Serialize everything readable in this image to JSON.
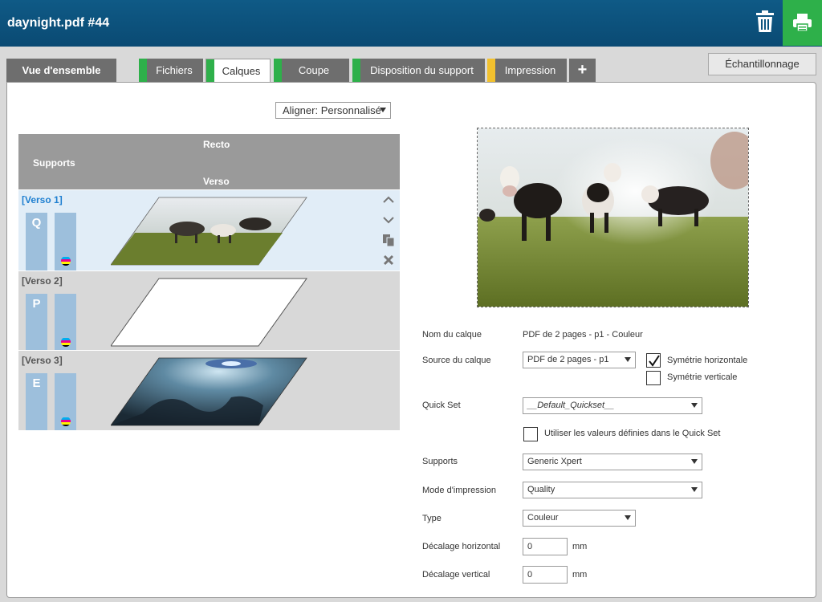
{
  "header": {
    "title": "daynight.pdf #44"
  },
  "icons": {
    "trash": "trash-icon",
    "print": "printer-icon"
  },
  "tabs": [
    {
      "label": "Vue d'ensemble"
    },
    {
      "label": "Fichiers",
      "stripe": "#2eb04a"
    },
    {
      "label": "Calques",
      "stripe": "#2eb04a"
    },
    {
      "label": "Coupe",
      "stripe": "#2eb04a"
    },
    {
      "label": "Disposition du support",
      "stripe": "#2eb04a"
    },
    {
      "label": "Impression",
      "stripe": "#f2c12e"
    }
  ],
  "add_tab": "+",
  "sample_button": "Échantillonnage",
  "align": {
    "value": "Aligner: Personnalisé"
  },
  "layers_header": {
    "recto": "Recto",
    "supports": "Supports",
    "verso": "Verso"
  },
  "layers": [
    {
      "title": "[Verso 1]",
      "media": "Q"
    },
    {
      "title": "[Verso 2]",
      "media": "P"
    },
    {
      "title": "[Verso 3]",
      "media": "E"
    }
  ],
  "form": {
    "layer_name_label": "Nom du calque",
    "layer_name_value": "PDF de 2 pages - p1 - Couleur",
    "source_label": "Source du calque",
    "source_value": "PDF de 2 pages - p1",
    "mirror_h_label": "Symétrie horizontale",
    "mirror_h_checked": true,
    "mirror_v_label": "Symétrie verticale",
    "mirror_v_checked": false,
    "quickset_label": "Quick Set",
    "quickset_value": "__Default_Quickset__",
    "use_quickset_label": "Utiliser les valeurs définies dans le Quick Set",
    "media_label": "Supports",
    "media_value": "Generic Xpert",
    "print_mode_label": "Mode d'impression",
    "print_mode_value": "Quality",
    "type_label": "Type",
    "type_value": "Couleur",
    "h_offset_label": "Décalage horizontal",
    "h_offset_value": "0",
    "v_offset_label": "Décalage vertical",
    "v_offset_value": "0",
    "unit": "mm"
  }
}
